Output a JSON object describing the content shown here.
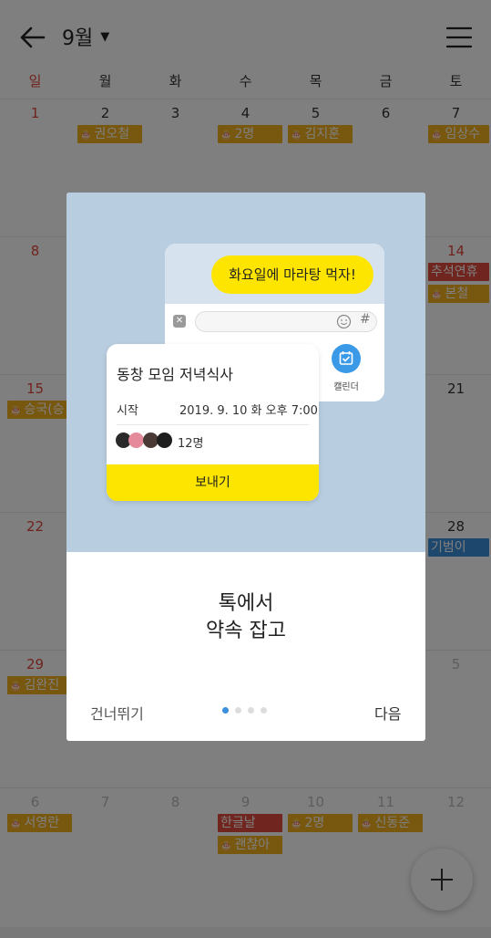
{
  "header": {
    "month": "9월",
    "caret": "▼"
  },
  "weekdays": [
    "일",
    "월",
    "화",
    "수",
    "목",
    "금",
    "토"
  ],
  "weeks": [
    {
      "days": [
        {
          "num": "1",
          "style": "sun"
        },
        {
          "num": "2"
        },
        {
          "num": "3"
        },
        {
          "num": "4"
        },
        {
          "num": "5"
        },
        {
          "num": "6"
        },
        {
          "num": "7"
        }
      ],
      "events": [
        {
          "label": "권오철",
          "col": 1,
          "color": "gold"
        },
        {
          "label": "2명",
          "col": 3,
          "color": "gold"
        },
        {
          "label": "김지훈",
          "col": 4,
          "color": "gold"
        },
        {
          "label": "임상수",
          "col": 6,
          "color": "gold"
        }
      ]
    },
    {
      "days": [
        {
          "num": "8",
          "style": "sun"
        },
        {
          "num": "14",
          "style": "red"
        }
      ],
      "events": [
        {
          "label": "추석연휴",
          "col": 6,
          "color": "red",
          "row": 0
        },
        {
          "label": "본철",
          "col": 6,
          "color": "gold",
          "row": 1
        }
      ]
    },
    {
      "days": [
        {
          "num": "15",
          "style": "sun"
        },
        {
          "num": "21"
        }
      ],
      "events": [
        {
          "label": "승국(승",
          "col": 0,
          "color": "gold"
        }
      ]
    },
    {
      "days": [
        {
          "num": "22",
          "style": "sun"
        },
        {
          "num": "28"
        }
      ],
      "events": [
        {
          "label": "기범이",
          "col": 6,
          "color": "blue"
        }
      ]
    },
    {
      "days": [
        {
          "num": "29",
          "style": "sun"
        },
        {
          "num": "5",
          "style": "muted"
        }
      ],
      "events": [
        {
          "label": "김완진",
          "col": 0,
          "color": "gold"
        }
      ]
    },
    {
      "days": [
        {
          "num": "6",
          "style": "muted"
        },
        {
          "num": "7",
          "style": "muted"
        },
        {
          "num": "8",
          "style": "muted"
        },
        {
          "num": "9",
          "style": "muted"
        },
        {
          "num": "10",
          "style": "muted"
        },
        {
          "num": "11",
          "style": "muted"
        },
        {
          "num": "12",
          "style": "muted"
        }
      ],
      "events": [
        {
          "label": "서영란",
          "col": 0,
          "color": "gold"
        },
        {
          "label": "한글날",
          "col": 3,
          "color": "red",
          "noicon": true
        },
        {
          "label": "괜찮아",
          "col": 3,
          "color": "gold",
          "row": 1
        },
        {
          "label": "2명",
          "col": 4,
          "color": "gold"
        },
        {
          "label": "신동준",
          "col": 5,
          "color": "gold"
        }
      ]
    }
  ],
  "modal": {
    "chat_message": "화요일에 마라탕 먹자!",
    "calendar_label": "캘린더",
    "event_title": "동창 모임 저녁식사",
    "start_label": "시작",
    "start_value": "2019. 9. 10 화   오후 7:00",
    "attendee_count": "12명",
    "send_label": "보내기",
    "headline_line1": "톡에서",
    "headline_line2": "약속 잡고",
    "skip_label": "건너뛰기",
    "next_label": "다음",
    "page_total": 4,
    "page_current": 1
  },
  "colors": {
    "accent_yellow": "#fee500",
    "event_gold": "#f0ae1d",
    "event_red": "#e04b3c",
    "event_blue": "#3a8fd8",
    "modal_art_bg": "#b8cde0",
    "dot_active": "#3a8fe0"
  },
  "icons": [
    "back-arrow-icon",
    "menu-icon",
    "caret-down-icon",
    "cake-icon",
    "close-icon",
    "smile-icon",
    "hash-icon",
    "calendar-check-icon",
    "plus-icon"
  ]
}
